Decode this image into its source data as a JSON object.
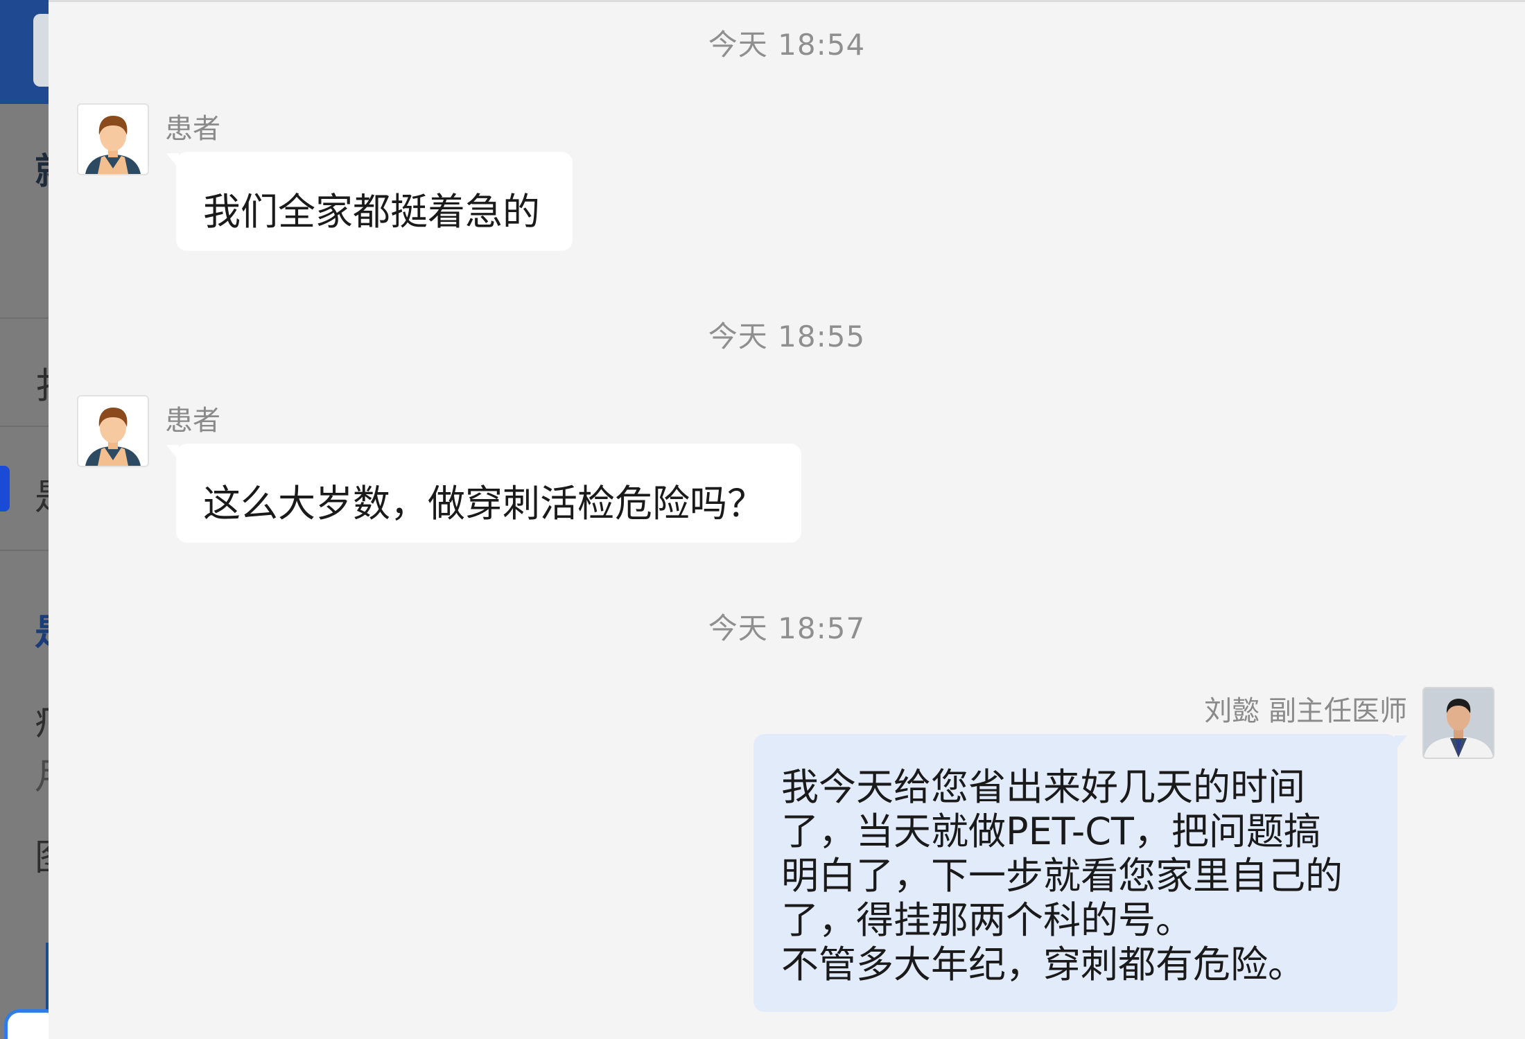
{
  "chat": {
    "messages": [
      {
        "timestamp": "今天 18:54",
        "sender": "患者",
        "direction": "incoming",
        "avatar": "patient-avatar",
        "text": "我们全家都挺着急的"
      },
      {
        "timestamp": "今天 18:55",
        "sender": "患者",
        "direction": "incoming",
        "avatar": "patient-avatar",
        "text": "这么大岁数，做穿刺活检危险吗？"
      },
      {
        "timestamp": "今天 18:57",
        "sender": "刘懿 副主任医师",
        "direction": "outgoing",
        "avatar": "doctor-photo",
        "text": "我今天给您省出来好几天的时间\n了，当天就做PET-CT，把问题搞\n明白了，下一步就看您家里自己的\n了，得挂那两个科的号。\n不管多大年纪，穿刺都有危险。"
      }
    ]
  },
  "background": {
    "partial_glyphs": [
      "就",
      "扌",
      "是",
      "是",
      "疒",
      "月",
      "图"
    ],
    "accent_color": "#1f4990"
  },
  "colors": {
    "panel_bg": "#f4f4f4",
    "incoming_bubble": "#ffffff",
    "outgoing_bubble": "#e1ebfa",
    "timestamp_text": "#8f8f8f",
    "sender_text": "#8a8a8a",
    "message_text": "#1a1a1a"
  }
}
